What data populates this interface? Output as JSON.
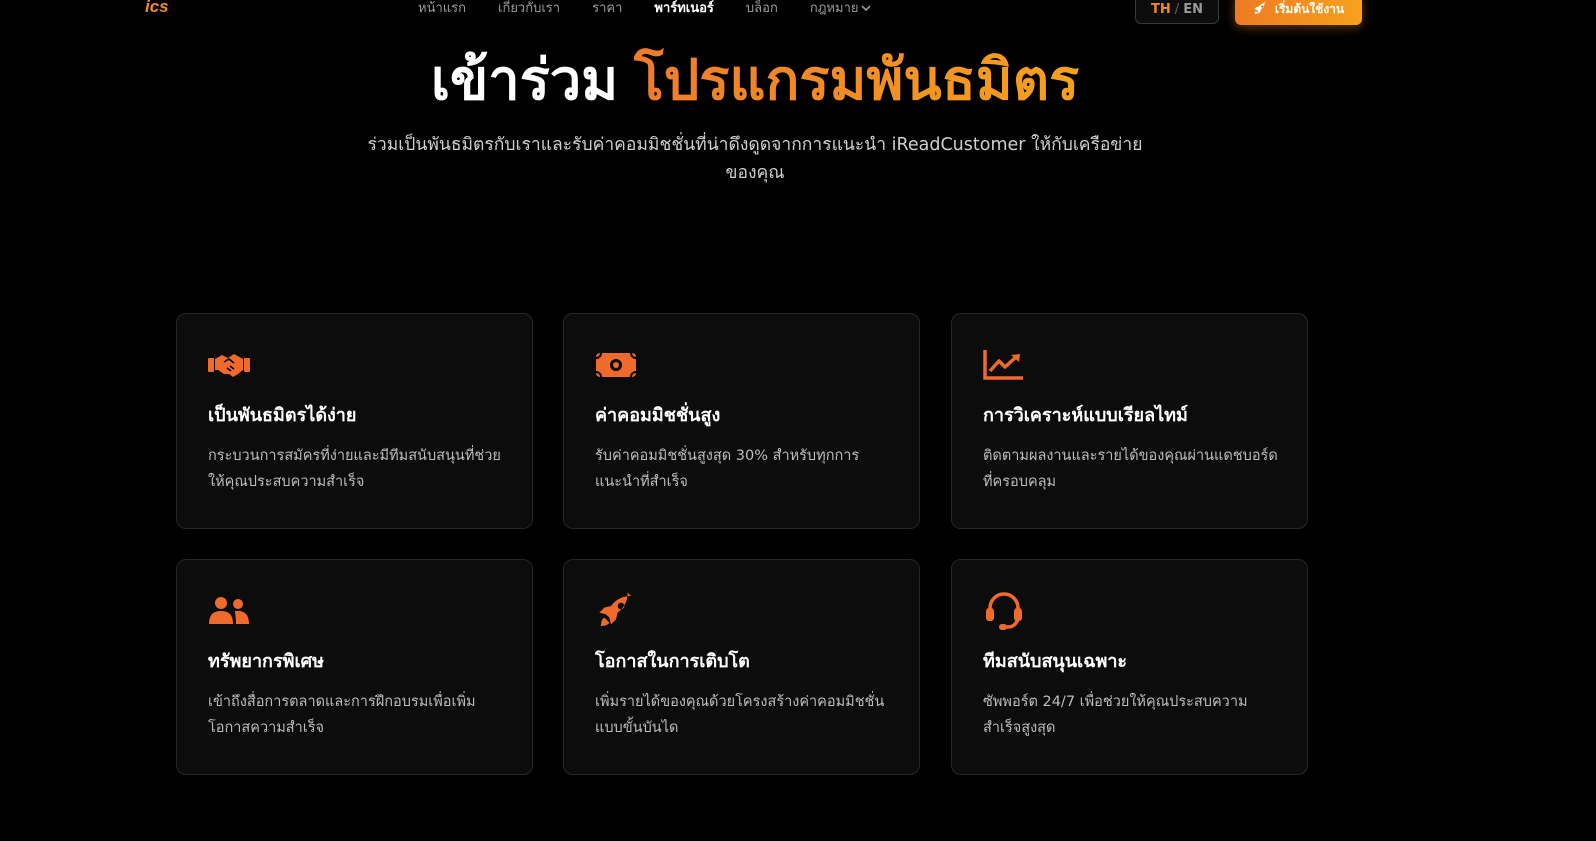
{
  "theme": {
    "accent": "#f08a24",
    "accent_end": "#f7a21b",
    "background": "#000000",
    "card_bg": "#0c0c0c"
  },
  "nav": {
    "logo_icon": "ics-logo-icon",
    "links": [
      {
        "label": "หน้าแรก"
      },
      {
        "label": "เกี่ยวกับเรา"
      },
      {
        "label": "ราคา"
      },
      {
        "label": "พาร์ทเนอร์"
      },
      {
        "label": "บล็อก"
      },
      {
        "label": "กฎหมาย"
      }
    ],
    "lang_th": "TH",
    "lang_sep": "/",
    "lang_en": "EN",
    "cta_label": "เริ่มต้นใช้งาน",
    "cta_icon": "rocket-icon"
  },
  "hero": {
    "title_part1": "เข้าร่วม ",
    "title_part2": "โปรแกรมพันธมิตร",
    "subtitle": "ร่วมเป็นพันธมิตรกับเราและรับค่าคอมมิชชั่นที่น่าดึงดูดจากการแนะนำ iReadCustomer ให้กับเครือข่ายของคุณ"
  },
  "features": [
    {
      "icon": "handshake-icon",
      "title": "เป็นพันธมิตรได้ง่าย",
      "desc": "กระบวนการสมัครที่ง่ายและมีทีมสนับสนุนที่ช่วยให้คุณประสบความสำเร็จ"
    },
    {
      "icon": "money-bill-icon",
      "title": "ค่าคอมมิชชั่นสูง",
      "desc": "รับค่าคอมมิชชั่นสูงสุด 30% สำหรับทุกการแนะนำที่สำเร็จ"
    },
    {
      "icon": "chart-line-icon",
      "title": "การวิเคราะห์แบบเรียลไทม์",
      "desc": "ติดตามผลงานและรายได้ของคุณผ่านแดชบอร์ดที่ครอบคลุม"
    },
    {
      "icon": "users-icon",
      "title": "ทรัพยากรพิเศษ",
      "desc": "เข้าถึงสื่อการตลาดและการฝึกอบรมเพื่อเพิ่มโอกาสความสำเร็จ"
    },
    {
      "icon": "rocket-icon",
      "title": "โอกาสในการเติบโต",
      "desc": "เพิ่มรายได้ของคุณด้วยโครงสร้างค่าคอมมิชชั่นแบบขั้นบันได"
    },
    {
      "icon": "headset-icon",
      "title": "ทีมสนับสนุนเฉพาะ",
      "desc": "ซัพพอร์ต 24/7 เพื่อช่วยให้คุณประสบความสำเร็จสูงสุด"
    }
  ]
}
